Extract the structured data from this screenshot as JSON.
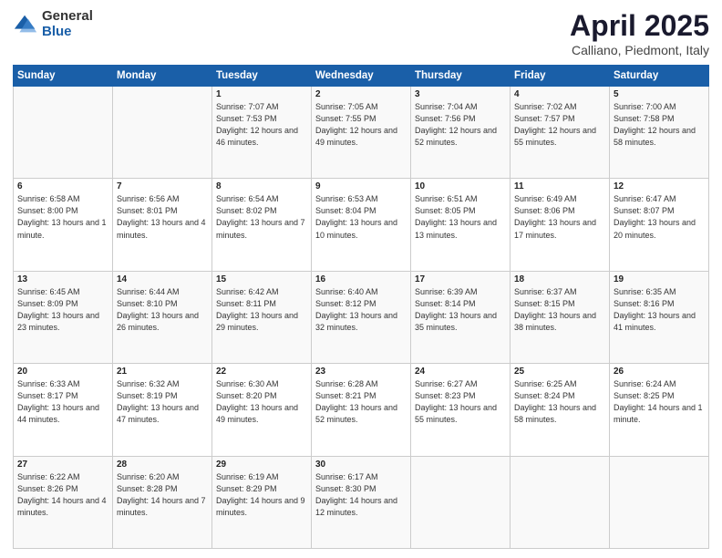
{
  "header": {
    "logo_general": "General",
    "logo_blue": "Blue",
    "title": "April 2025",
    "subtitle": "Calliano, Piedmont, Italy"
  },
  "calendar": {
    "days_of_week": [
      "Sunday",
      "Monday",
      "Tuesday",
      "Wednesday",
      "Thursday",
      "Friday",
      "Saturday"
    ],
    "weeks": [
      [
        {
          "day": "",
          "info": ""
        },
        {
          "day": "",
          "info": ""
        },
        {
          "day": "1",
          "info": "Sunrise: 7:07 AM\nSunset: 7:53 PM\nDaylight: 12 hours and 46 minutes."
        },
        {
          "day": "2",
          "info": "Sunrise: 7:05 AM\nSunset: 7:55 PM\nDaylight: 12 hours and 49 minutes."
        },
        {
          "day": "3",
          "info": "Sunrise: 7:04 AM\nSunset: 7:56 PM\nDaylight: 12 hours and 52 minutes."
        },
        {
          "day": "4",
          "info": "Sunrise: 7:02 AM\nSunset: 7:57 PM\nDaylight: 12 hours and 55 minutes."
        },
        {
          "day": "5",
          "info": "Sunrise: 7:00 AM\nSunset: 7:58 PM\nDaylight: 12 hours and 58 minutes."
        }
      ],
      [
        {
          "day": "6",
          "info": "Sunrise: 6:58 AM\nSunset: 8:00 PM\nDaylight: 13 hours and 1 minute."
        },
        {
          "day": "7",
          "info": "Sunrise: 6:56 AM\nSunset: 8:01 PM\nDaylight: 13 hours and 4 minutes."
        },
        {
          "day": "8",
          "info": "Sunrise: 6:54 AM\nSunset: 8:02 PM\nDaylight: 13 hours and 7 minutes."
        },
        {
          "day": "9",
          "info": "Sunrise: 6:53 AM\nSunset: 8:04 PM\nDaylight: 13 hours and 10 minutes."
        },
        {
          "day": "10",
          "info": "Sunrise: 6:51 AM\nSunset: 8:05 PM\nDaylight: 13 hours and 13 minutes."
        },
        {
          "day": "11",
          "info": "Sunrise: 6:49 AM\nSunset: 8:06 PM\nDaylight: 13 hours and 17 minutes."
        },
        {
          "day": "12",
          "info": "Sunrise: 6:47 AM\nSunset: 8:07 PM\nDaylight: 13 hours and 20 minutes."
        }
      ],
      [
        {
          "day": "13",
          "info": "Sunrise: 6:45 AM\nSunset: 8:09 PM\nDaylight: 13 hours and 23 minutes."
        },
        {
          "day": "14",
          "info": "Sunrise: 6:44 AM\nSunset: 8:10 PM\nDaylight: 13 hours and 26 minutes."
        },
        {
          "day": "15",
          "info": "Sunrise: 6:42 AM\nSunset: 8:11 PM\nDaylight: 13 hours and 29 minutes."
        },
        {
          "day": "16",
          "info": "Sunrise: 6:40 AM\nSunset: 8:12 PM\nDaylight: 13 hours and 32 minutes."
        },
        {
          "day": "17",
          "info": "Sunrise: 6:39 AM\nSunset: 8:14 PM\nDaylight: 13 hours and 35 minutes."
        },
        {
          "day": "18",
          "info": "Sunrise: 6:37 AM\nSunset: 8:15 PM\nDaylight: 13 hours and 38 minutes."
        },
        {
          "day": "19",
          "info": "Sunrise: 6:35 AM\nSunset: 8:16 PM\nDaylight: 13 hours and 41 minutes."
        }
      ],
      [
        {
          "day": "20",
          "info": "Sunrise: 6:33 AM\nSunset: 8:17 PM\nDaylight: 13 hours and 44 minutes."
        },
        {
          "day": "21",
          "info": "Sunrise: 6:32 AM\nSunset: 8:19 PM\nDaylight: 13 hours and 47 minutes."
        },
        {
          "day": "22",
          "info": "Sunrise: 6:30 AM\nSunset: 8:20 PM\nDaylight: 13 hours and 49 minutes."
        },
        {
          "day": "23",
          "info": "Sunrise: 6:28 AM\nSunset: 8:21 PM\nDaylight: 13 hours and 52 minutes."
        },
        {
          "day": "24",
          "info": "Sunrise: 6:27 AM\nSunset: 8:23 PM\nDaylight: 13 hours and 55 minutes."
        },
        {
          "day": "25",
          "info": "Sunrise: 6:25 AM\nSunset: 8:24 PM\nDaylight: 13 hours and 58 minutes."
        },
        {
          "day": "26",
          "info": "Sunrise: 6:24 AM\nSunset: 8:25 PM\nDaylight: 14 hours and 1 minute."
        }
      ],
      [
        {
          "day": "27",
          "info": "Sunrise: 6:22 AM\nSunset: 8:26 PM\nDaylight: 14 hours and 4 minutes."
        },
        {
          "day": "28",
          "info": "Sunrise: 6:20 AM\nSunset: 8:28 PM\nDaylight: 14 hours and 7 minutes."
        },
        {
          "day": "29",
          "info": "Sunrise: 6:19 AM\nSunset: 8:29 PM\nDaylight: 14 hours and 9 minutes."
        },
        {
          "day": "30",
          "info": "Sunrise: 6:17 AM\nSunset: 8:30 PM\nDaylight: 14 hours and 12 minutes."
        },
        {
          "day": "",
          "info": ""
        },
        {
          "day": "",
          "info": ""
        },
        {
          "day": "",
          "info": ""
        }
      ]
    ]
  }
}
